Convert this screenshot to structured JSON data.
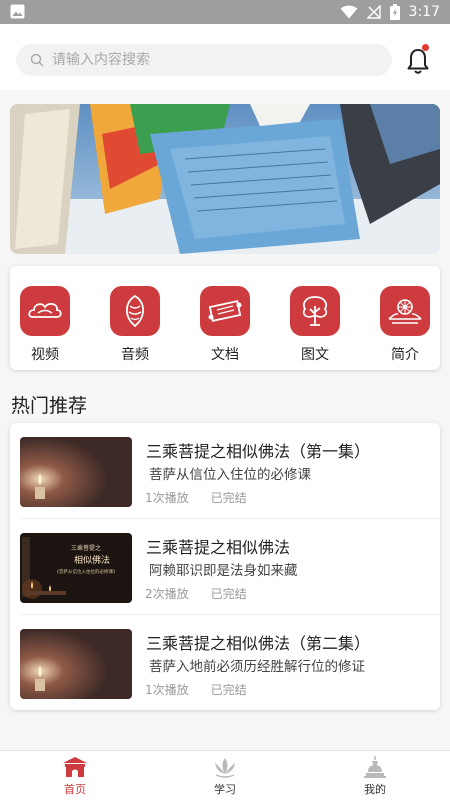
{
  "status_bar": {
    "time": "3:17"
  },
  "search": {
    "placeholder": "请输入内容搜索"
  },
  "categories": [
    {
      "label": "视频",
      "icon": "cloud-icon"
    },
    {
      "label": "音频",
      "icon": "conch-icon"
    },
    {
      "label": "文档",
      "icon": "scroll-icon"
    },
    {
      "label": "图文",
      "icon": "tree-icon"
    },
    {
      "label": "简介",
      "icon": "dharma-wheel-icon"
    }
  ],
  "section_title": "热门推荐",
  "recommendations": [
    {
      "title": "三乘菩提之相似佛法（第一集）",
      "subtitle": "菩萨从信位入住位的必修课",
      "plays": "1次播放",
      "status": "已完结"
    },
    {
      "title": "三乘菩提之相似佛法",
      "subtitle": "阿赖耶识即是法身如来藏",
      "plays": "2次播放",
      "status": "已完结",
      "thumb_text": [
        "三乘菩提之",
        "相似佛法",
        "《菩萨从信位入住位的必修课》"
      ]
    },
    {
      "title": "三乘菩提之相似佛法（第二集）",
      "subtitle": "菩萨入地前必须历经胜解行位的修证",
      "plays": "1次播放",
      "status": "已完结"
    }
  ],
  "tabs": [
    {
      "label": "首页",
      "active": true
    },
    {
      "label": "学习",
      "active": false
    },
    {
      "label": "我的",
      "active": false
    }
  ],
  "colors": {
    "accent": "#cd3b3e",
    "status_bar": "#9e9e9e",
    "notification_dot": "#e53935"
  }
}
